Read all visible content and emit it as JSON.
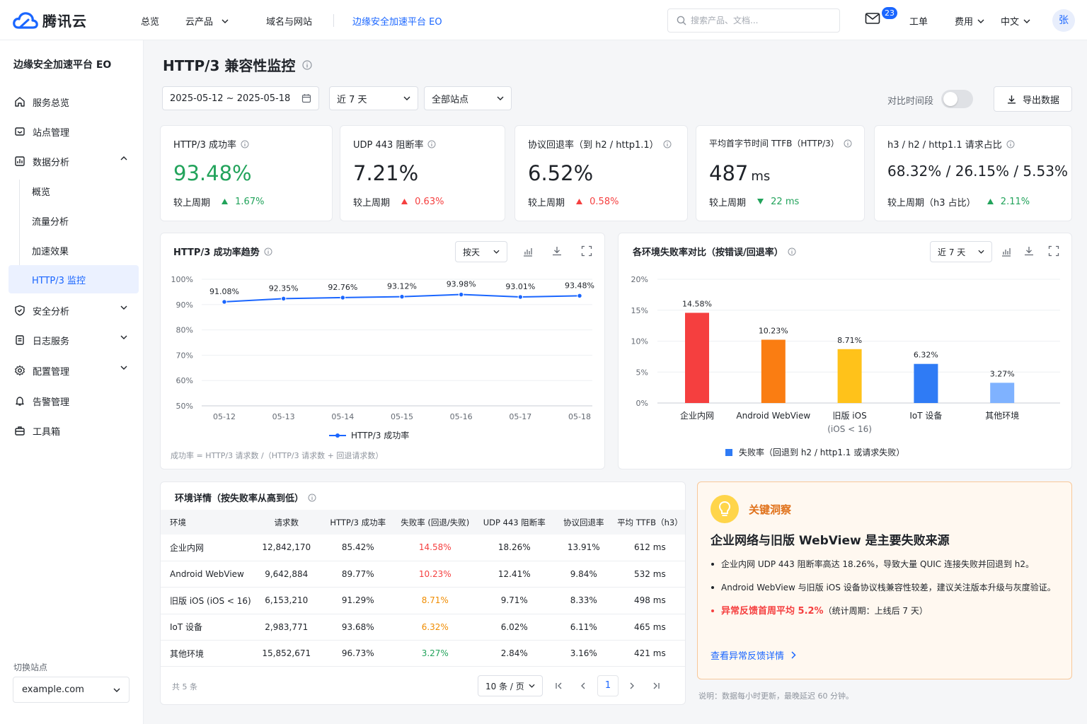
{
  "topbar": {
    "brand": "腾讯云",
    "nav": [
      "总览",
      "云产品",
      "域名与网站",
      "边缘安全加速平台 EO"
    ],
    "search_placeholder": "搜索产品、文档...",
    "mail_count": "23",
    "ticket": "工单",
    "billing": "费用",
    "language": "中文",
    "avatar": "张"
  },
  "sidebar": {
    "title": "边缘安全加速平台 EO",
    "items": [
      {
        "label": "服务总览",
        "icon": "home-icon"
      },
      {
        "label": "站点管理",
        "icon": "site-icon"
      },
      {
        "label": "数据分析",
        "icon": "chart-icon"
      },
      {
        "label": "概览"
      },
      {
        "label": "流量分析"
      },
      {
        "label": "加速效果"
      },
      {
        "label": "HTTP/3 监控"
      },
      {
        "label": "安全分析",
        "icon": "shield-icon"
      },
      {
        "label": "日志服务",
        "icon": "log-icon"
      },
      {
        "label": "配置管理",
        "icon": "gear-icon"
      },
      {
        "label": "告警管理",
        "icon": "bell-icon"
      },
      {
        "label": "工具箱",
        "icon": "toolbox-icon"
      }
    ],
    "switch_label": "切换站点",
    "site": "example.com"
  },
  "page": {
    "title": "HTTP/3 兼容性监控",
    "date_range": "2025-05-12 ~ 2025-05-18",
    "period": "近 7 天",
    "station": "全部站点",
    "compare_label": "对比时间段",
    "export": "导出数据"
  },
  "kpis": [
    {
      "label": "HTTP/3 成功率",
      "value": "93.48%",
      "cmp_label": "较上周期",
      "delta": "1.67%"
    },
    {
      "label": "UDP 443 阻断率",
      "value": "7.21%",
      "cmp_label": "较上周期",
      "delta": "0.63%"
    },
    {
      "label": "协议回退率（到 h2 / http1.1）",
      "value": "6.52%",
      "cmp_label": "较上周期",
      "delta": "0.58%"
    },
    {
      "label": "平均首字节时间 TTFB（HTTP/3）",
      "value": "487",
      "unit": "ms",
      "cmp_label": "较上周期",
      "delta": "22 ms"
    },
    {
      "label": "h3 / h2 / http1.1 请求占比",
      "value": "68.32% / 26.15% / 5.53%",
      "cmp_label": "较上周期（h3 占比）",
      "delta": "2.11%"
    }
  ],
  "colors": {
    "accent": "#1a66ff",
    "good": "#22a35b",
    "bad": "#f53f3f",
    "warn": "#f08c00"
  },
  "trend": {
    "title": "HTTP/3 成功率趋势",
    "granularity": "按天",
    "formula": "成功率 = HTTP/3 请求数 /（HTTP/3 请求数 + 回退请求数）"
  },
  "failure": {
    "title": "各环境失败率对比（按错误/回退率）",
    "period": "近 7 天"
  },
  "chart_data": [
    {
      "type": "line",
      "title": "HTTP/3 成功率趋势",
      "x": [
        "05-12",
        "05-13",
        "05-14",
        "05-15",
        "05-16",
        "05-17",
        "05-18"
      ],
      "series": [
        {
          "name": "HTTP/3 成功率",
          "values": [
            91.08,
            92.35,
            92.76,
            93.12,
            93.98,
            93.01,
            93.48
          ]
        }
      ],
      "data_labels": [
        "91.08%",
        "92.35%",
        "92.76%",
        "93.12%",
        "93.98%",
        "93.01%",
        "93.48%"
      ],
      "yticks": [
        "100%",
        "90%",
        "80%",
        "70%",
        "60%",
        "50%"
      ],
      "ylim": [
        50,
        100
      ],
      "y_unit": "%",
      "grid": true,
      "legend": "bottom"
    },
    {
      "type": "bar",
      "title": "各环境失败率对比（按错误/回退率）",
      "categories": [
        "企业内网",
        "Android WebView",
        "旧版 iOS",
        "IoT 设备",
        "其他环境"
      ],
      "category_sub": [
        "",
        "",
        "(iOS < 16)",
        "",
        ""
      ],
      "series": [
        {
          "name": "失败率（回退到 h2 / http1.1 或请求失败）",
          "values": [
            14.58,
            10.23,
            8.71,
            6.32,
            3.27
          ]
        }
      ],
      "data_labels": [
        "14.58%",
        "10.23%",
        "8.71%",
        "6.32%",
        "3.27%"
      ],
      "bar_colors": [
        "#f53f3f",
        "#fa7d12",
        "#ffc21a",
        "#2f7bf5",
        "#7fb2ff"
      ],
      "legend_color": "#2f7bf5",
      "yticks": [
        "20%",
        "15%",
        "10%",
        "5%",
        "0%"
      ],
      "ylim": [
        0,
        20
      ],
      "y_unit": "%",
      "grid": true,
      "legend": "bottom"
    }
  ],
  "table": {
    "title": "环境详情（按失败率从高到低）",
    "headers": [
      "环境",
      "请求数",
      "HTTP/3 成功率",
      "失败率 (回退/失败)",
      "UDP 443 阻断率",
      "协议回退率",
      "平均 TTFB（h3）"
    ],
    "rows": [
      [
        "企业内网",
        "12,842,170",
        "85.42%",
        "14.58%",
        "18.26%",
        "13.91%",
        "612 ms"
      ],
      [
        "Android WebView",
        "9,642,884",
        "89.77%",
        "10.23%",
        "12.41%",
        "9.84%",
        "532 ms"
      ],
      [
        "旧版 iOS (iOS < 16)",
        "6,153,210",
        "91.29%",
        "8.71%",
        "9.71%",
        "8.33%",
        "498 ms"
      ],
      [
        "IoT 设备",
        "2,983,771",
        "93.68%",
        "6.32%",
        "6.02%",
        "6.11%",
        "465 ms"
      ],
      [
        "其他环境",
        "15,852,671",
        "96.73%",
        "3.27%",
        "2.84%",
        "3.16%",
        "421 ms"
      ]
    ],
    "total": "共 5 条",
    "page_size": "10 条 / 页",
    "page": "1"
  },
  "insight": {
    "tag": "关键洞察",
    "headline": "企业网络与旧版 WebView 是主要失败来源",
    "bullets": [
      "企业内网 UDP 443 阻断率高达 18.26%，导致大量 QUIC 连接失败并回退到 h2。",
      "Android WebView 与旧版 iOS 设备协议栈兼容性较差，建议关注版本升级与灰度验证。"
    ],
    "warn_em": "异常反馈首周平均 5.2%",
    "warn_rest": "（统计周期：上线后 7 天）",
    "link": "查看异常反馈详情",
    "note": "说明：数据每小时更新，最晚延迟 60 分钟。"
  }
}
